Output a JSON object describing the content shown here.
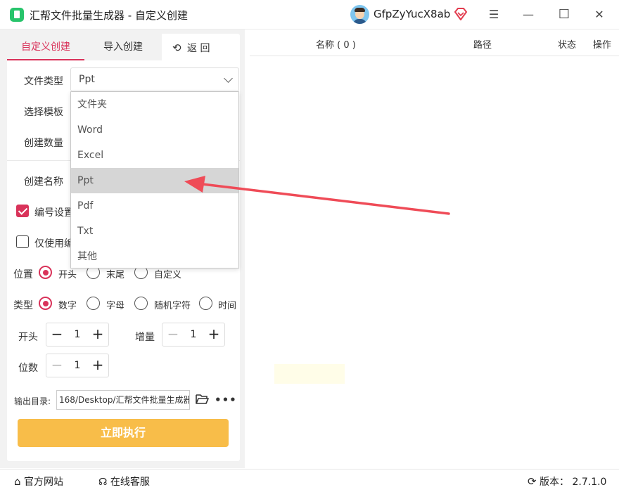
{
  "window": {
    "title": "汇帮文件批量生成器 - 自定义创建",
    "username": "GfpZyYucX8ab",
    "minimize": "—",
    "maximize": "☐",
    "close": "✕",
    "menu": "☰"
  },
  "tabs": [
    {
      "label": "自定义创建",
      "active": true
    },
    {
      "label": "导入创建",
      "active": false
    }
  ],
  "back_label": "返  回",
  "form": {
    "file_type_label": "文件类型",
    "file_type_value": "Ppt",
    "template_label": "选择模板",
    "count_label": "创建数量",
    "name_label": "创建名称",
    "numbering_label": "编号设置",
    "numbering_checked": true,
    "only_number_label": "仅使用编",
    "only_number_checked": false,
    "position_label": "位置",
    "position_options": [
      "开头",
      "末尾",
      "自定义"
    ],
    "position_selected": "开头",
    "type_label": "类型",
    "type_options": [
      "数字",
      "字母",
      "随机字符",
      "时间"
    ],
    "type_selected": "数字",
    "start_label": "开头",
    "start_value": "1",
    "increment_label": "增量",
    "increment_value": "1",
    "digits_label": "位数",
    "digits_value": "1",
    "output_label": "输出目录:",
    "output_path": "168/Desktop/汇帮文件批量生成器",
    "run_label": "立即执行"
  },
  "dropdown": {
    "options": [
      "文件夹",
      "Word",
      "Excel",
      "Ppt",
      "Pdf",
      "Txt",
      "其他"
    ],
    "selected": "Ppt"
  },
  "table": {
    "headers": [
      "名称 ( 0 )",
      "路径",
      "状态",
      "操作"
    ]
  },
  "footer": {
    "website": "官方网站",
    "support": "在线客服",
    "version_label": "版本：",
    "version": "2.7.1.0"
  },
  "colors": {
    "accent": "#d9335a",
    "run_button": "#f8bd49",
    "arrow": "#ef4b57"
  }
}
